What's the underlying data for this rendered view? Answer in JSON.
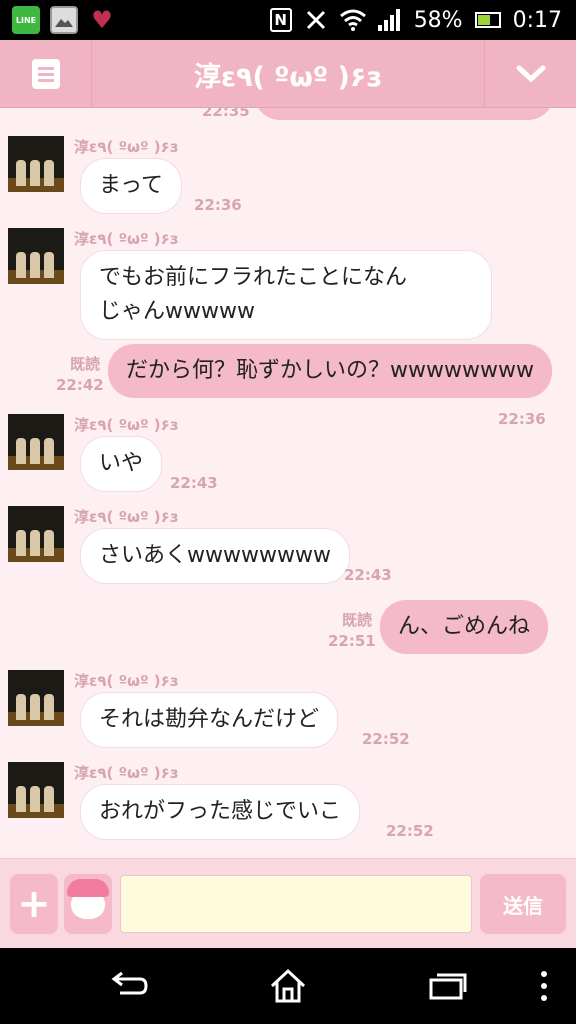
{
  "status_bar": {
    "notifications": [
      {
        "icon": "line-app-icon",
        "label": "LINE"
      },
      {
        "icon": "gallery-icon"
      },
      {
        "icon": "heart-app-icon"
      }
    ],
    "nfc": "N",
    "battery": "58%",
    "time": "0:17"
  },
  "header": {
    "title": "淳ε٩( ºωº )۶з",
    "menu_icon": "menu-icon",
    "expand_icon": "chevron-down-icon"
  },
  "chat": {
    "partial_time": "22:35",
    "messages": [
      {
        "direction": "in",
        "sender": "淳ε٩( ºωº )۶з",
        "lines": [
          "まって"
        ],
        "time": "22:36"
      },
      {
        "direction": "in",
        "sender": "淳ε٩( ºωº )۶з",
        "lines": [
          "でもお前にフラれたことになん",
          "じゃんwwwww"
        ],
        "time": "22:36"
      },
      {
        "direction": "out",
        "read": "既読",
        "lines": [
          "だから何？恥ずかしいの？wwwwwwww"
        ],
        "time": "22:42"
      },
      {
        "direction": "in",
        "sender": "淳ε٩( ºωº )۶з",
        "lines": [
          "いや"
        ],
        "time": "22:43"
      },
      {
        "direction": "in",
        "sender": "淳ε٩( ºωº )۶з",
        "lines": [
          "さいあくwwwwwwww"
        ],
        "time": "22:43"
      },
      {
        "direction": "out",
        "read": "既読",
        "lines": [
          "ん、ごめんね"
        ],
        "time": "22:51"
      },
      {
        "direction": "in",
        "sender": "淳ε٩( ºωº )۶з",
        "lines": [
          "それは勘弁なんだけど"
        ],
        "time": "22:52"
      },
      {
        "direction": "in",
        "sender": "淳ε٩( ºωº )۶з",
        "lines": [
          "おれがフった感じでいこ"
        ],
        "time": "22:52"
      }
    ]
  },
  "input_bar": {
    "plus": "+",
    "input_value": "",
    "send_label": "送信"
  },
  "nav_bar": {
    "back_icon": "back-icon",
    "home_icon": "home-icon",
    "recents_icon": "recent-apps-icon",
    "more_icon": "more-vertical-icon"
  },
  "colors": {
    "header": "#f0b4c4",
    "chat_bg": "#fdeff2",
    "outgoing_bubble": "#f4bac9",
    "incoming_bubble": "#ffffff",
    "meta_text": "#d8a4b2"
  }
}
